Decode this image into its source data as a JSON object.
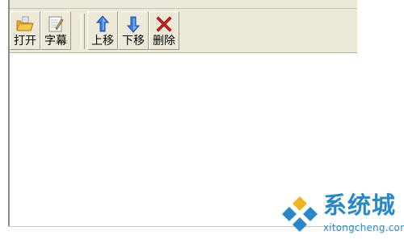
{
  "toolbar": {
    "buttons": [
      {
        "label": "打开",
        "icon": "open-folder-icon"
      },
      {
        "label": "字幕",
        "icon": "subtitle-edit-icon"
      },
      {
        "label": "上移",
        "icon": "arrow-up-icon"
      },
      {
        "label": "下移",
        "icon": "arrow-down-icon"
      },
      {
        "label": "删除",
        "icon": "delete-x-icon"
      }
    ]
  },
  "watermark": {
    "brand": "系统城",
    "url": "xitongcheng.com",
    "color": "#2a87c8"
  },
  "colors": {
    "toolbar_bg": "#ece9d8",
    "arrow_blue": "#2f6fd8",
    "delete_red": "#d81e1e"
  }
}
